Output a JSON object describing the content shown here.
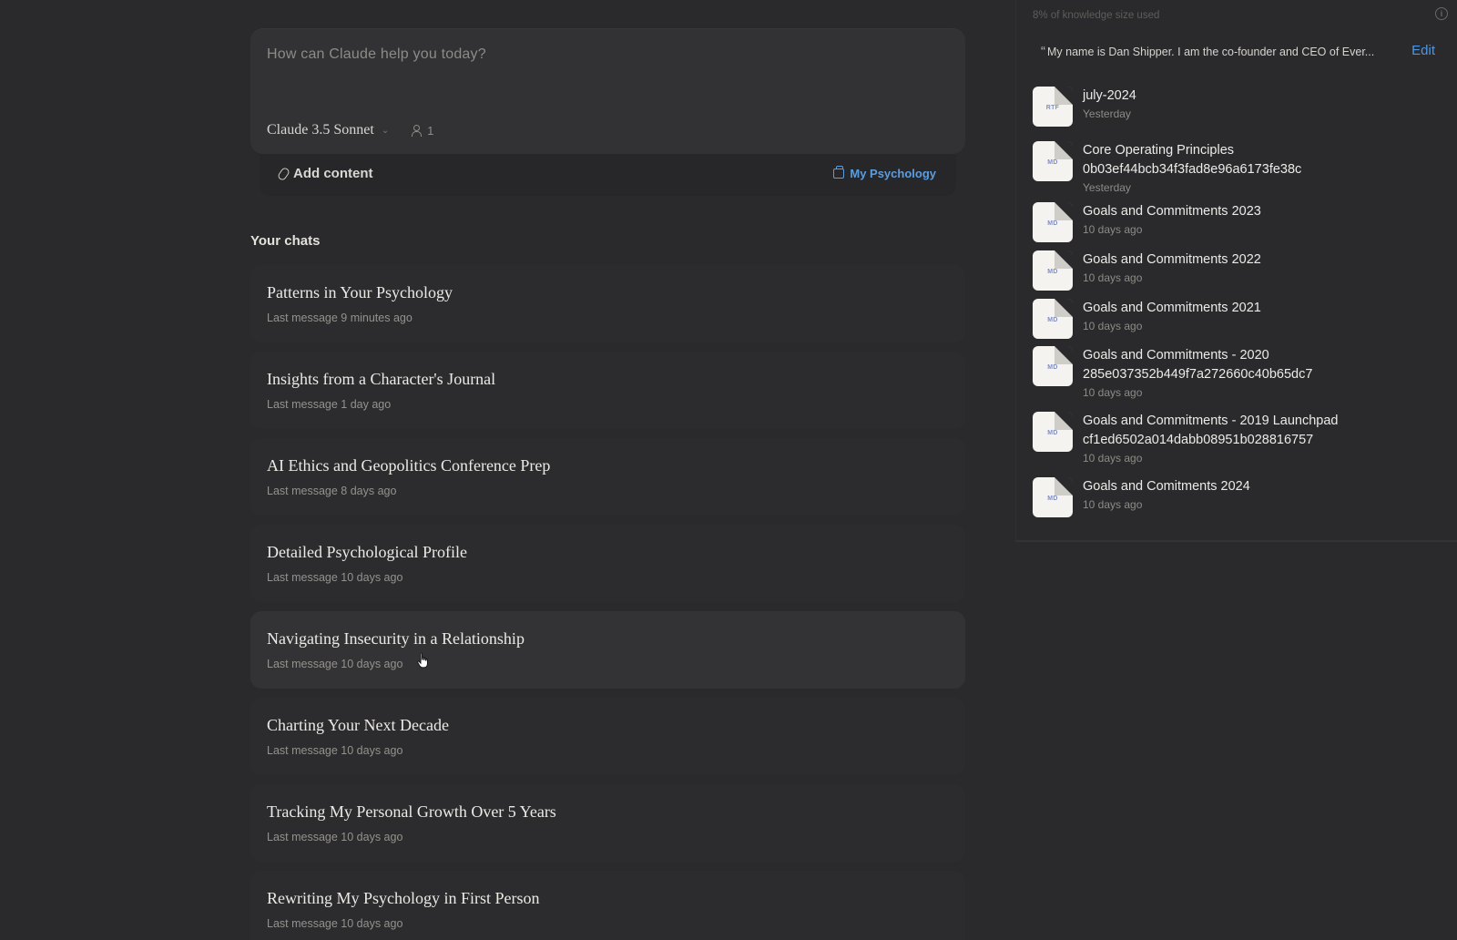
{
  "composer": {
    "placeholder": "How can Claude help you today?",
    "model": "Claude 3.5 Sonnet",
    "participant_count": "1",
    "add_content_label": "Add content",
    "project_label": "My Psychology"
  },
  "chats": {
    "section_title": "Your chats",
    "items": [
      {
        "title": "Patterns in Your Psychology",
        "meta": "Last message 9 minutes ago"
      },
      {
        "title": "Insights from a Character's Journal",
        "meta": "Last message 1 day ago"
      },
      {
        "title": "AI Ethics and Geopolitics Conference Prep",
        "meta": "Last message 8 days ago"
      },
      {
        "title": "Detailed Psychological Profile",
        "meta": "Last message 10 days ago"
      },
      {
        "title": "Navigating Insecurity in a Relationship",
        "meta": "Last message 10 days ago"
      },
      {
        "title": "Charting Your Next Decade",
        "meta": "Last message 10 days ago"
      },
      {
        "title": "Tracking My Personal Growth Over 5 Years",
        "meta": "Last message 10 days ago"
      },
      {
        "title": "Rewriting My Psychology in First Person",
        "meta": "Last message 10 days ago"
      }
    ]
  },
  "knowledge": {
    "usage_text": "8% of knowledge size used",
    "instructions_text": "My name is Dan Shipper. I am the co-founder and CEO of Ever...",
    "edit_label": "Edit",
    "files": [
      {
        "ext": "RTF",
        "name_lines": [
          "july-2024"
        ],
        "date": "Yesterday"
      },
      {
        "ext": "MD",
        "name_lines": [
          "Core Operating Principles",
          "0b03ef44bcb34f3fad8e96a6173fe38c"
        ],
        "date": "Yesterday"
      },
      {
        "ext": "MD",
        "name_lines": [
          "Goals and Commitments 2023"
        ],
        "date": "10 days ago"
      },
      {
        "ext": "MD",
        "name_lines": [
          "Goals and Commitments 2022"
        ],
        "date": "10 days ago"
      },
      {
        "ext": "MD",
        "name_lines": [
          "Goals and Commitments 2021"
        ],
        "date": "10 days ago"
      },
      {
        "ext": "MD",
        "name_lines": [
          "Goals and Commitments - 2020",
          "285e037352b449f7a272660c40b65dc7"
        ],
        "date": "10 days ago"
      },
      {
        "ext": "MD",
        "name_lines": [
          "Goals and Commitments - 2019 Launchpad",
          "cf1ed6502a014dabb08951b028816757"
        ],
        "date": "10 days ago"
      },
      {
        "ext": "MD",
        "name_lines": [
          "Goals and Comitments 2024"
        ],
        "date": "10 days ago"
      }
    ]
  },
  "colors": {
    "background": "#2a2a2c",
    "card": "#323234",
    "link_blue": "#4f96e0"
  }
}
